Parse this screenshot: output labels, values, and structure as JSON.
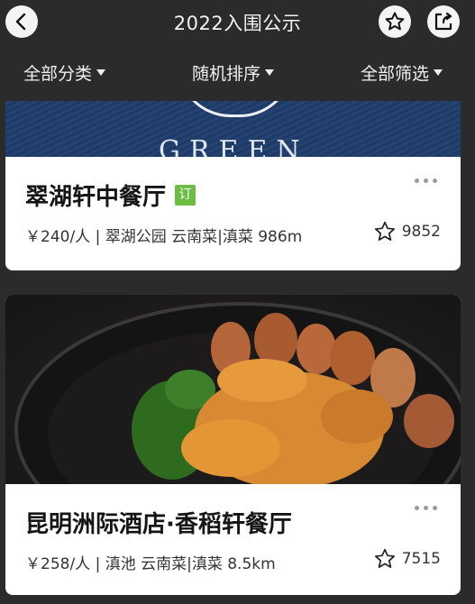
{
  "header": {
    "title": "2022入围公示",
    "icons": {
      "back": "back-arrow-icon",
      "favorite": "star-icon",
      "share": "share-icon"
    }
  },
  "filters": [
    {
      "label": "全部分类"
    },
    {
      "label": "随机排序"
    },
    {
      "label": "全部筛选"
    }
  ],
  "restaurants": [
    {
      "name": "翠湖轩中餐厅",
      "tag": "订",
      "banner_text": "GREEN",
      "meta": "￥240/人 | 翠湖公园  云南菜|滇菜  986m",
      "favorites": "9852"
    },
    {
      "name": "昆明洲际酒店·香稻轩餐厅",
      "meta": "￥258/人 | 滇池  云南菜|滇菜  8.5km",
      "favorites": "7515"
    }
  ],
  "colors": {
    "tag": "#6dbd45",
    "background": "#2b2b2b",
    "banner": "#1f3a66"
  }
}
